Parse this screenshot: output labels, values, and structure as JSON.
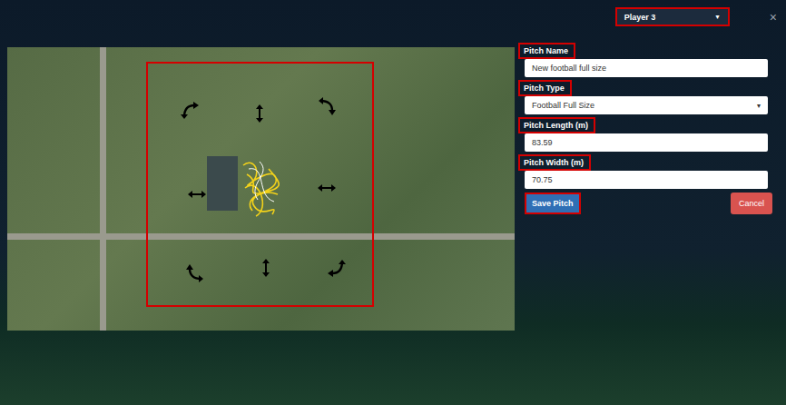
{
  "player_select": {
    "value": "Player 3",
    "caret": "▼",
    "highlighted": true
  },
  "close": "×",
  "form": {
    "fields": [
      {
        "label": "Pitch Name",
        "value": "New football full size",
        "kind": "text",
        "highlighted": true
      },
      {
        "label": "Pitch Type",
        "value": "Football Full Size",
        "kind": "select",
        "caret": "▾",
        "highlighted": true
      },
      {
        "label": "Pitch Length (m)",
        "value": "83.59",
        "kind": "text",
        "highlighted": true
      },
      {
        "label": "Pitch Width (m)",
        "value": "70.75",
        "kind": "text",
        "highlighted": true
      }
    ]
  },
  "buttons": [
    {
      "label": "Save Pitch",
      "kind": "primary",
      "highlighted": true
    },
    {
      "label": "Cancel",
      "kind": "danger",
      "highlighted": false
    }
  ]
}
